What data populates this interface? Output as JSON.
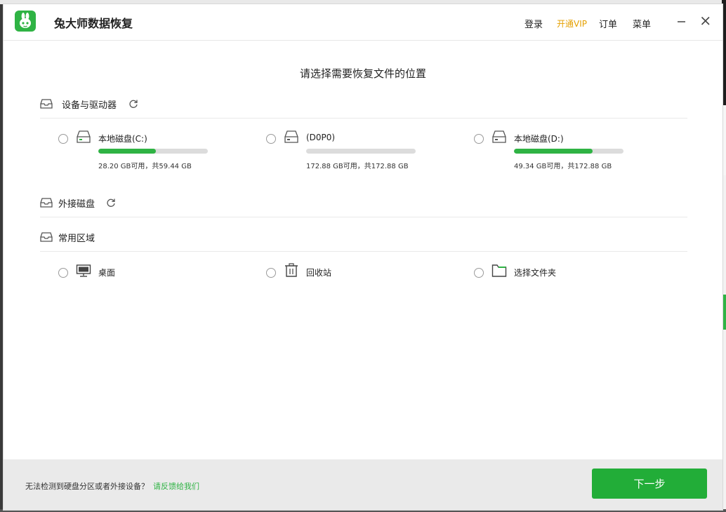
{
  "app": {
    "title": "兔大师数据恢复"
  },
  "nav": {
    "login": "登录",
    "vip": "开通VIP",
    "orders": "订单",
    "menu": "菜单"
  },
  "main": {
    "title": "请选择需要恢复文件的位置"
  },
  "sections": {
    "devices": "设备与驱动器",
    "external": "外接磁盘",
    "common": "常用区域"
  },
  "drives": [
    {
      "name": "本地磁盘(C:)",
      "size": "28.20 GB可用，共59.44 GB",
      "used_fraction": 0.526
    },
    {
      "name": "(D0P0)",
      "size": "172.88 GB可用，共172.88 GB",
      "used_fraction": 0.0
    },
    {
      "name": "本地磁盘(D:)",
      "size": "49.34 GB可用，共172.88 GB",
      "used_fraction": 0.715
    }
  ],
  "areas": [
    {
      "label": "桌面",
      "icon": "monitor-icon"
    },
    {
      "label": "回收站",
      "icon": "recycle-bin-icon"
    },
    {
      "label": "选择文件夹",
      "icon": "folder-icon"
    }
  ],
  "footer": {
    "hint": "无法检测到硬盘分区或者外接设备？",
    "link": "请反馈给我们",
    "next": "下一步"
  },
  "colors": {
    "accent": "#2fb344",
    "button": "#22ad38",
    "vip": "#e5a000"
  }
}
